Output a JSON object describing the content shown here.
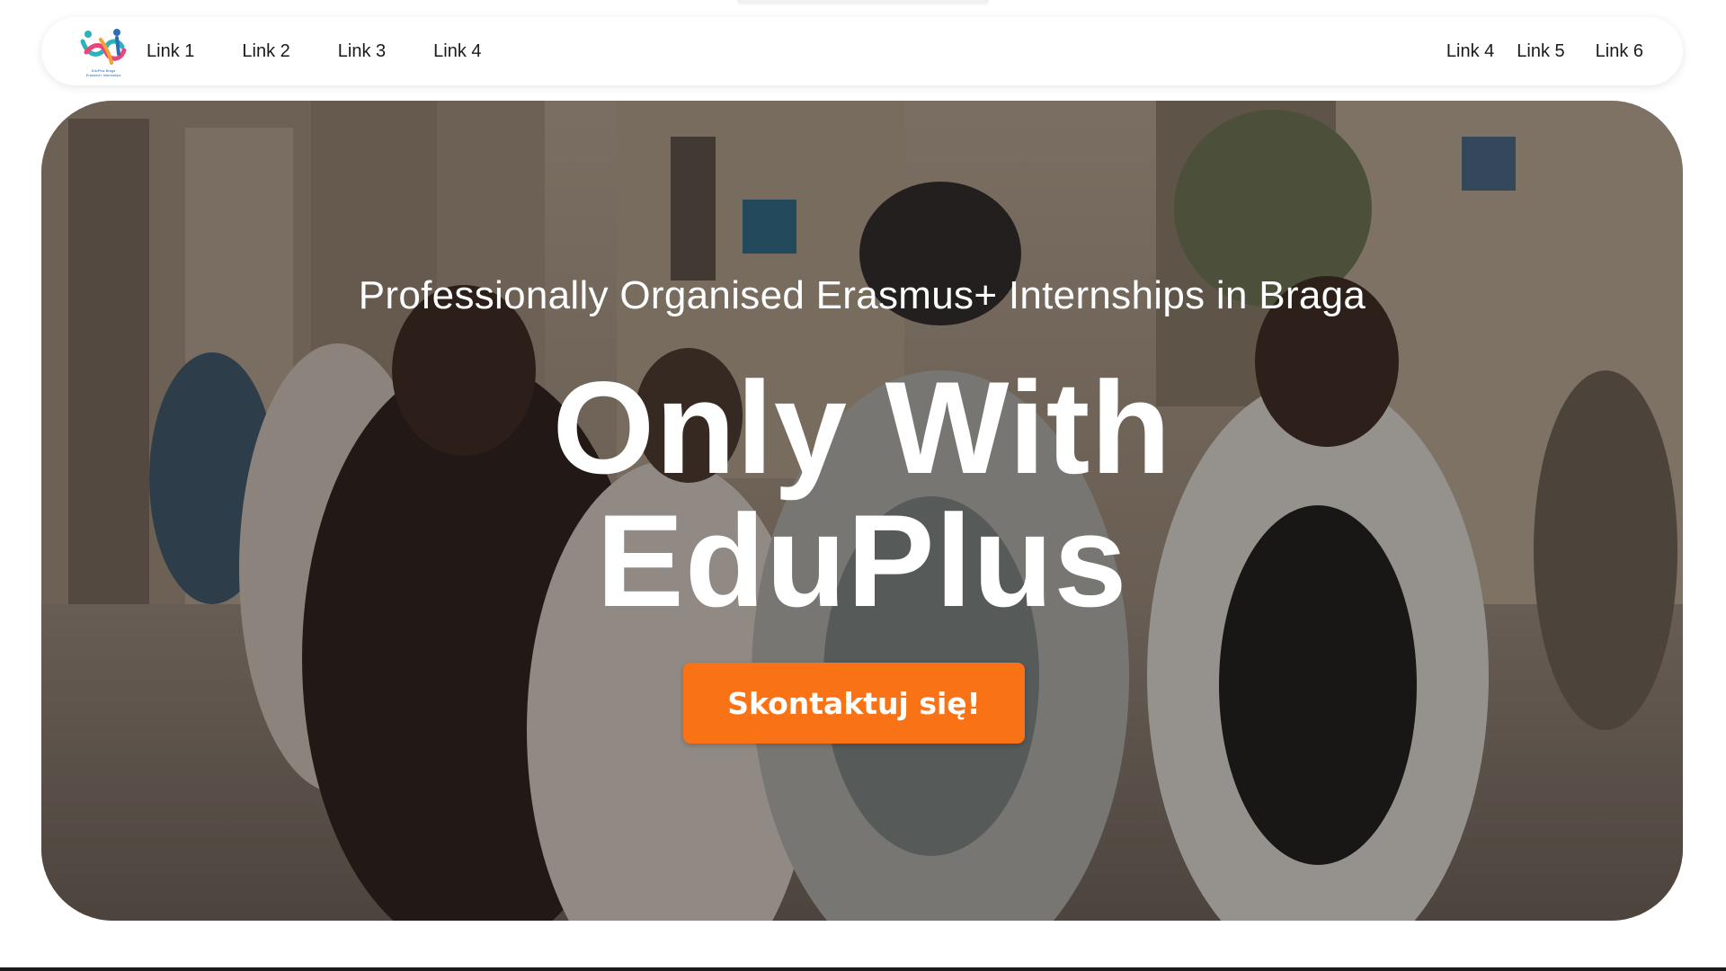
{
  "brand": {
    "logo_caption_line1": "EduPlus Braga",
    "logo_caption_line2": "Erasmus+ Internships",
    "colors": {
      "accent": "#f97316",
      "logo_teal": "#2ab3b8",
      "logo_pink": "#e8457a",
      "logo_blue": "#2a6fb5",
      "logo_orange": "#f4a23a"
    }
  },
  "nav": {
    "left_links": [
      "Link 1",
      "Link 2",
      "Link 3",
      "Link 4"
    ],
    "right_links": [
      "Link 4",
      "Link 5",
      "Link 6"
    ]
  },
  "hero": {
    "subtitle": "Professionally Organised Erasmus+ Internships in Braga",
    "title_line1": "Only With",
    "title_line2": "EduPlus",
    "cta_label": "Skontaktuj się!",
    "background_icon": "street-photo-students-backpacks"
  }
}
